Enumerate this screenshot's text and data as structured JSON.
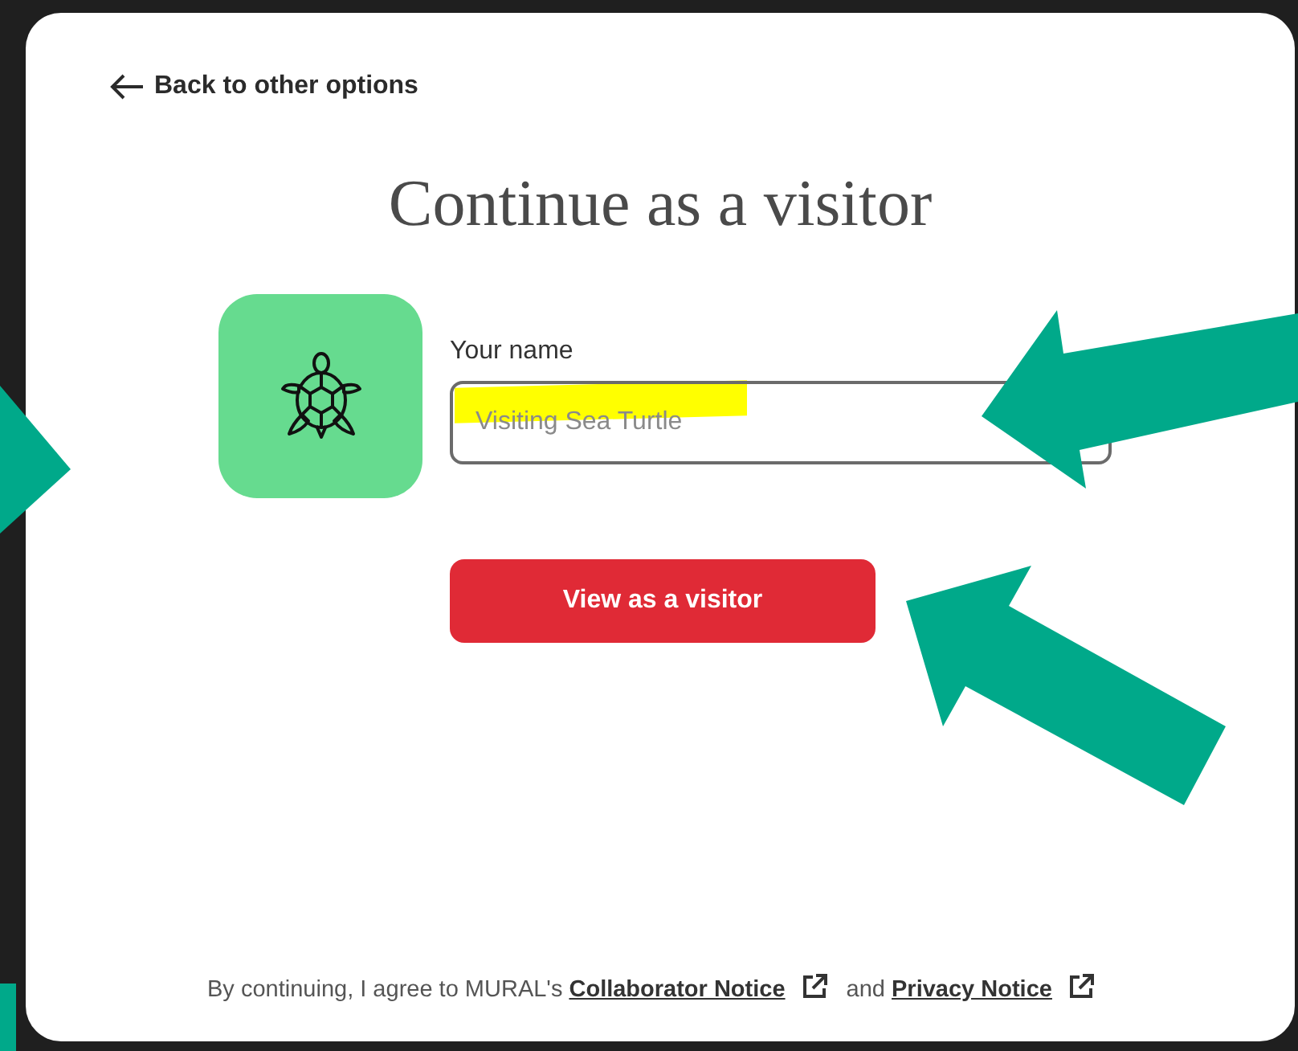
{
  "back_link": {
    "label": "Back to other options"
  },
  "title": "Continue as a visitor",
  "name_field": {
    "label": "Your name",
    "placeholder": "Visiting Sea Turtle",
    "highlighted": true
  },
  "submit_button": {
    "label": "View as a visitor"
  },
  "footer": {
    "parts": [
      {
        "kind": "text",
        "text": "By continuing, I agree to MURAL's"
      },
      {
        "kind": "link",
        "text": "Collaborator Notice",
        "external": true
      },
      {
        "kind": "text",
        "text": "and"
      },
      {
        "kind": "link",
        "text": "Privacy Notice",
        "external": true
      }
    ]
  }
}
